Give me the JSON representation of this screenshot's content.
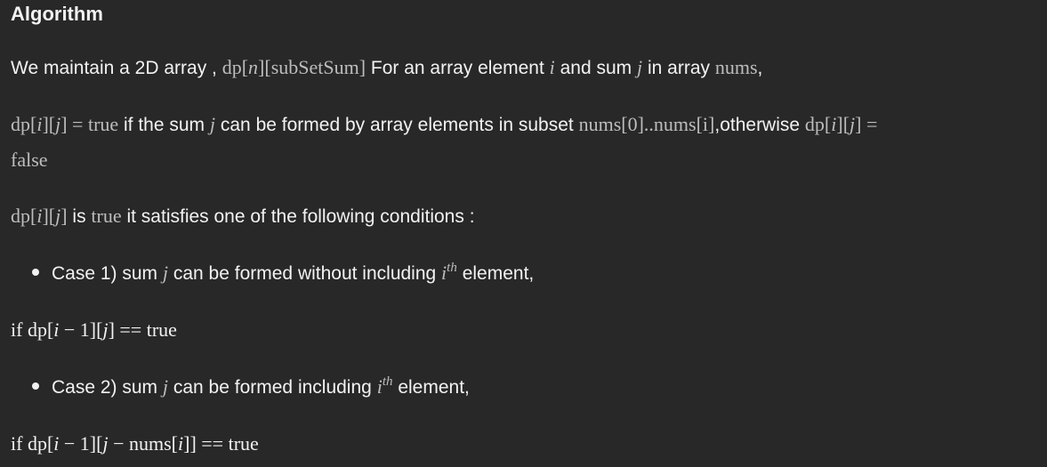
{
  "heading": "Algorithm",
  "intro": {
    "t1": "We maintain a 2D array ,",
    "m1_a": "dp[",
    "m1_n": "n",
    "m1_b": "][subSetSum]",
    "t2": "For an array element",
    "m_i": "i",
    "t3": "and sum",
    "m_j": "j",
    "t4": "in array",
    "m_nums": "nums",
    "t5": ","
  },
  "def": {
    "m_a": "dp[",
    "m_i": "i",
    "m_b": "][",
    "m_j": "j",
    "m_c": "] = true",
    "t1": "if the sum",
    "m_j2": "j",
    "t2": "can be formed by array elements in subset",
    "m_sub": "nums[0]..nums[i]",
    "t3": ",otherwise",
    "m_d": "dp[",
    "m_i2": "i",
    "m_e": "][",
    "m_j3": "j",
    "m_f": "] =",
    "m_false": "false"
  },
  "cond_intro": {
    "m_a": "dp[",
    "m_i": "i",
    "m_b": "][",
    "m_j": "j",
    "m_c": "]",
    "t1": "is",
    "m_true": "true",
    "t2": "it satisfies one of the following conditions :"
  },
  "case1": {
    "t1": "Case 1) sum",
    "m_j": "j",
    "t2": "can be formed without including",
    "m_i": "i",
    "sup": "th",
    "t3": "element,"
  },
  "cond1": {
    "m_a": "if dp[",
    "m_i": "i",
    "m_b": " − 1][",
    "m_j": "j",
    "m_c": "] == true"
  },
  "case2": {
    "t1": "Case 2) sum",
    "m_j": "j",
    "t2": "can be formed including",
    "m_i": "i",
    "sup": "th",
    "t3": "element,"
  },
  "cond2": {
    "m_a": "if dp[",
    "m_i": "i",
    "m_b": " − 1][",
    "m_j": "j",
    "m_c": " − nums[",
    "m_i2": "i",
    "m_d": "]] == true"
  }
}
